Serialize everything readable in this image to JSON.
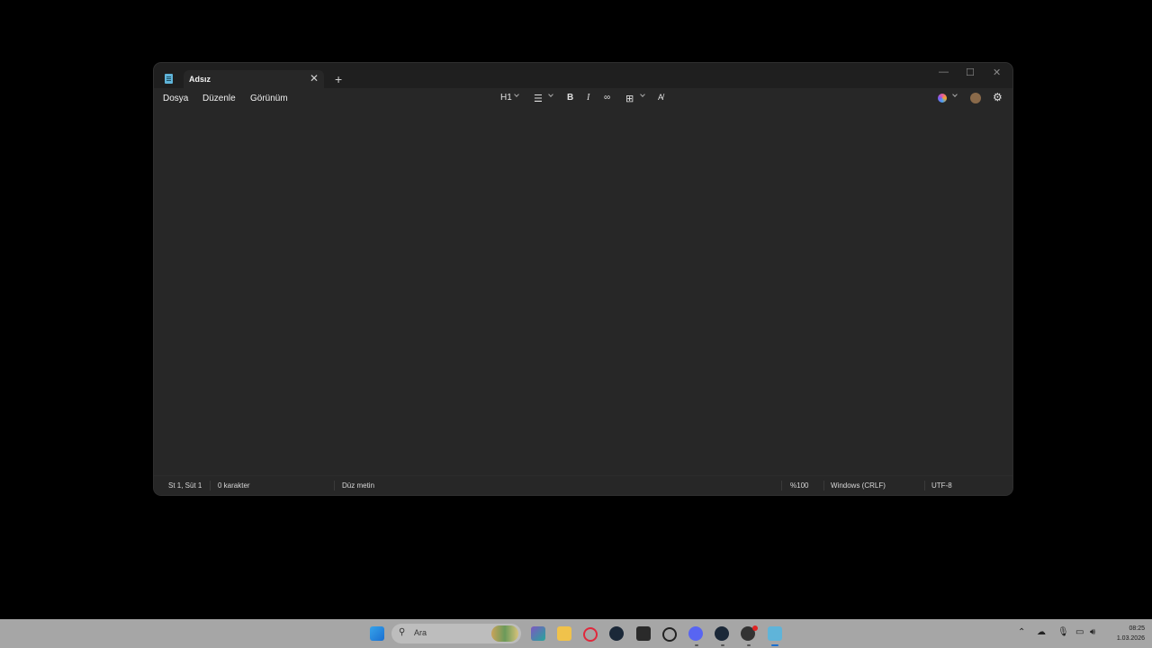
{
  "window": {
    "tab_title": "Adsız",
    "menu": [
      "Dosya",
      "Düzenle",
      "Görünüm"
    ],
    "toolbar": {
      "heading": "H1"
    },
    "status": {
      "position": "St 1, Süt 1",
      "characters": "0 karakter",
      "format": "Düz metin",
      "zoom": "%100",
      "line_ending": "Windows (CRLF)",
      "encoding": "UTF-8"
    }
  },
  "taskbar": {
    "search_placeholder": "Ara",
    "time": "08:25",
    "date": "1.03.2026",
    "icons": [
      "windows-start-icon",
      "search-icon",
      "widget-icon",
      "app-icon",
      "file-explorer-icon",
      "opera-icon",
      "steam-icon",
      "epic-games-icon",
      "obs-icon",
      "discord-icon",
      "steam-icon",
      "app-icon",
      "notepad-icon"
    ]
  },
  "colors": {
    "window_bg": "#272727",
    "titlebar_bg": "#1f1f1f",
    "taskbar_bg": "#a6a6a6",
    "desktop_bg": "#000000"
  }
}
